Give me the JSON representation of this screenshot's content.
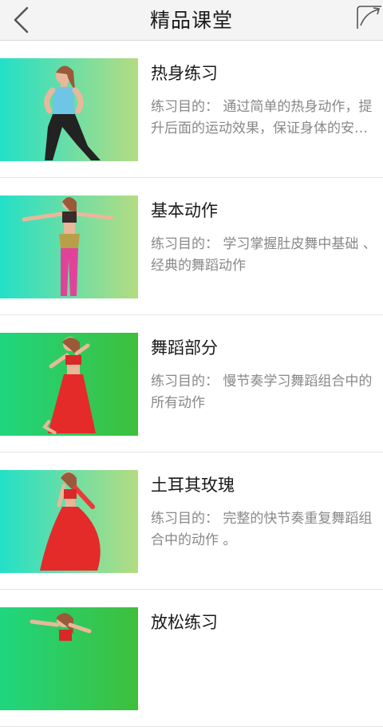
{
  "header": {
    "title": "精品课堂",
    "back_icon": "chevron-left-icon",
    "share_icon": "share-icon"
  },
  "lessons": [
    {
      "title": "热身练习",
      "desc": "练习目的： 通过简单的热身动作，提升后面的运动效果，保证身体的安全。",
      "thumb_colors": [
        "#22e0c8",
        "#b4dc82"
      ]
    },
    {
      "title": "基本动作",
      "desc": "练习目的： 学习掌握肚皮舞中基础 、经典的舞蹈动作",
      "thumb_colors": [
        "#22e0c8",
        "#b4dc82"
      ]
    },
    {
      "title": "舞蹈部分",
      "desc": "练习目的： 慢节奏学习舞蹈组合中的所有动作",
      "thumb_colors": [
        "#1fd67f",
        "#3fbf3c"
      ]
    },
    {
      "title": "土耳其玫瑰",
      "desc": "练习目的： 完整的快节奏重复舞蹈组合中的动作 。",
      "thumb_colors": [
        "#22e0c8",
        "#b4dc82"
      ]
    },
    {
      "title": "放松练习",
      "desc": "",
      "thumb_colors": [
        "#1fd67f",
        "#3fbf3c"
      ]
    }
  ]
}
